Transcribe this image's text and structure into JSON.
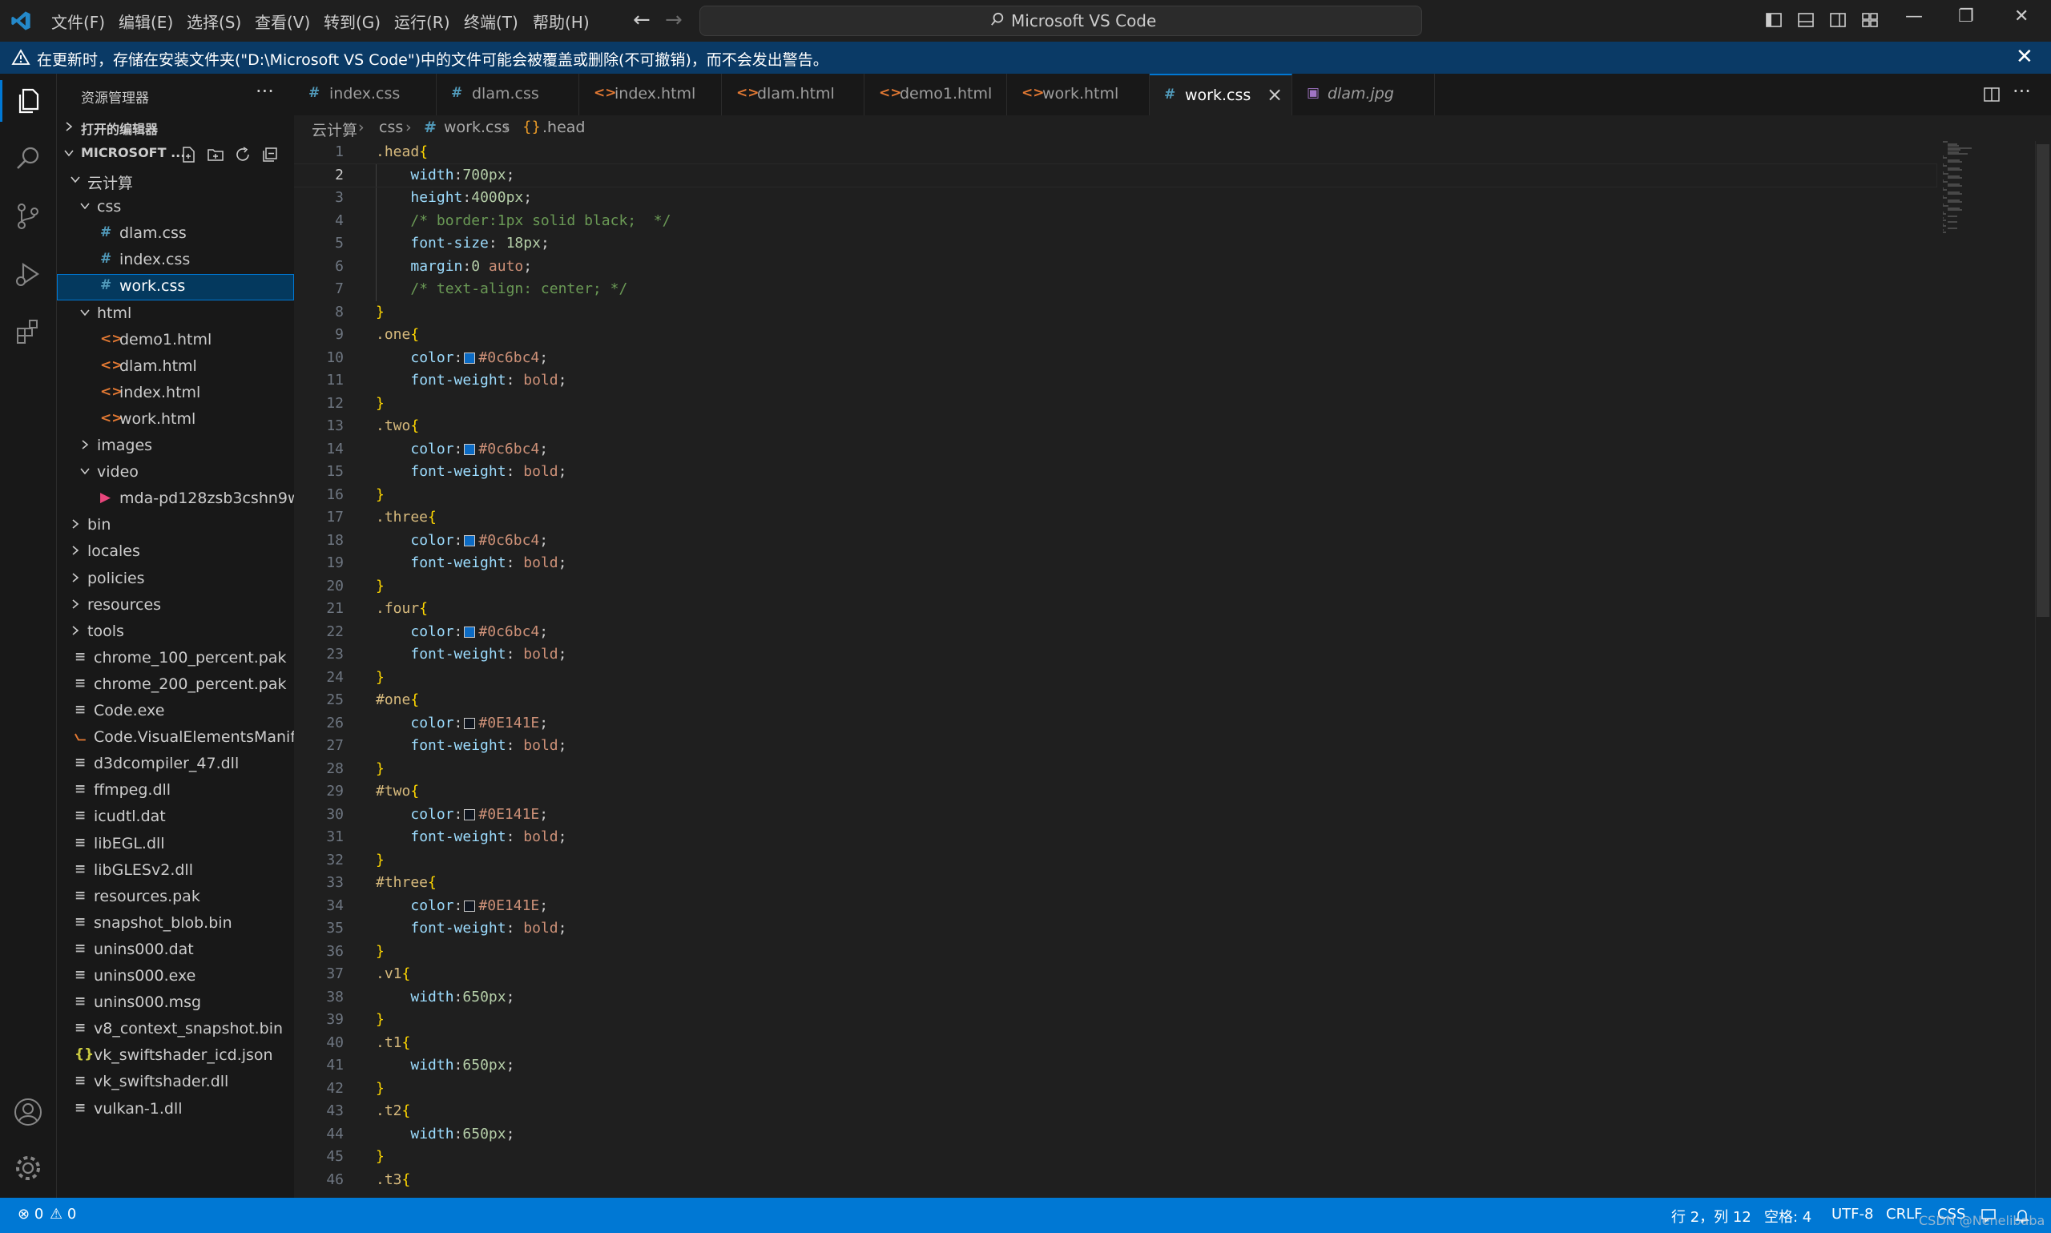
{
  "titlebar": {
    "menus": [
      "文件(F)",
      "编辑(E)",
      "选择(S)",
      "查看(V)",
      "转到(G)",
      "运行(R)",
      "终端(T)",
      "帮助(H)"
    ],
    "command_center": "Microsoft VS Code",
    "window_controls": {
      "minimize": "—",
      "restore": "❐",
      "close": "✕"
    }
  },
  "notification": {
    "message": "在更新时，存储在安装文件夹(\"D:\\Microsoft VS Code\")中的文件可能会被覆盖或删除(不可撤销)，而不会发出警告。",
    "close": "✕"
  },
  "sidebar": {
    "title": "资源管理器",
    "more": "···",
    "open_editors": "打开的编辑器",
    "folder_header": "MICROSOFT ...",
    "tree": [
      {
        "label": "云计算",
        "depth": 1,
        "kind": "folder",
        "open": true
      },
      {
        "label": "css",
        "depth": 2,
        "kind": "folder",
        "open": true
      },
      {
        "label": "dlam.css",
        "depth": 3,
        "kind": "css"
      },
      {
        "label": "index.css",
        "depth": 3,
        "kind": "css"
      },
      {
        "label": "work.css",
        "depth": 3,
        "kind": "css",
        "selected": true
      },
      {
        "label": "html",
        "depth": 2,
        "kind": "folder",
        "open": true
      },
      {
        "label": "demo1.html",
        "depth": 3,
        "kind": "html"
      },
      {
        "label": "dlam.html",
        "depth": 3,
        "kind": "html"
      },
      {
        "label": "index.html",
        "depth": 3,
        "kind": "html"
      },
      {
        "label": "work.html",
        "depth": 3,
        "kind": "html"
      },
      {
        "label": "images",
        "depth": 2,
        "kind": "folder",
        "open": false
      },
      {
        "label": "video",
        "depth": 2,
        "kind": "folder",
        "open": true
      },
      {
        "label": "mda-pd128zsb3cshn9w...",
        "depth": 3,
        "kind": "video"
      },
      {
        "label": "bin",
        "depth": 1,
        "kind": "folder",
        "open": false
      },
      {
        "label": "locales",
        "depth": 1,
        "kind": "folder",
        "open": false
      },
      {
        "label": "policies",
        "depth": 1,
        "kind": "folder",
        "open": false
      },
      {
        "label": "resources",
        "depth": 1,
        "kind": "folder",
        "open": false
      },
      {
        "label": "tools",
        "depth": 1,
        "kind": "folder",
        "open": false
      },
      {
        "label": "chrome_100_percent.pak",
        "depth": 1,
        "kind": "file"
      },
      {
        "label": "chrome_200_percent.pak",
        "depth": 1,
        "kind": "file"
      },
      {
        "label": "Code.exe",
        "depth": 1,
        "kind": "file"
      },
      {
        "label": "Code.VisualElementsManif...",
        "depth": 1,
        "kind": "rss"
      },
      {
        "label": "d3dcompiler_47.dll",
        "depth": 1,
        "kind": "file"
      },
      {
        "label": "ffmpeg.dll",
        "depth": 1,
        "kind": "file"
      },
      {
        "label": "icudtl.dat",
        "depth": 1,
        "kind": "file"
      },
      {
        "label": "libEGL.dll",
        "depth": 1,
        "kind": "file"
      },
      {
        "label": "libGLESv2.dll",
        "depth": 1,
        "kind": "file"
      },
      {
        "label": "resources.pak",
        "depth": 1,
        "kind": "file"
      },
      {
        "label": "snapshot_blob.bin",
        "depth": 1,
        "kind": "file"
      },
      {
        "label": "unins000.dat",
        "depth": 1,
        "kind": "file"
      },
      {
        "label": "unins000.exe",
        "depth": 1,
        "kind": "file"
      },
      {
        "label": "unins000.msg",
        "depth": 1,
        "kind": "file"
      },
      {
        "label": "v8_context_snapshot.bin",
        "depth": 1,
        "kind": "file"
      },
      {
        "label": "vk_swiftshader_icd.json",
        "depth": 1,
        "kind": "json"
      },
      {
        "label": "vk_swiftshader.dll",
        "depth": 1,
        "kind": "file"
      },
      {
        "label": "vulkan-1.dll",
        "depth": 1,
        "kind": "file"
      }
    ]
  },
  "tabs": [
    {
      "label": "index.css",
      "kind": "css"
    },
    {
      "label": "dlam.css",
      "kind": "css"
    },
    {
      "label": "index.html",
      "kind": "html"
    },
    {
      "label": "dlam.html",
      "kind": "html"
    },
    {
      "label": "demo1.html",
      "kind": "html"
    },
    {
      "label": "work.html",
      "kind": "html"
    },
    {
      "label": "work.css",
      "kind": "css",
      "active": true
    },
    {
      "label": "dlam.jpg",
      "kind": "image",
      "preview": true
    }
  ],
  "breadcrumb": [
    "云计算",
    "css",
    "work.css",
    ".head"
  ],
  "editor": {
    "current_line": 2,
    "lines": [
      [
        [
          "sel",
          ".head"
        ],
        [
          "brace",
          "{"
        ]
      ],
      [
        [
          "ind",
          ""
        ],
        [
          "prop",
          "width"
        ],
        [
          "pun",
          ":"
        ],
        [
          "num",
          "700px"
        ],
        [
          "pun",
          ";"
        ]
      ],
      [
        [
          "ind",
          ""
        ],
        [
          "prop",
          "height"
        ],
        [
          "pun",
          ":"
        ],
        [
          "num",
          "4000px"
        ],
        [
          "pun",
          ";"
        ]
      ],
      [
        [
          "ind",
          ""
        ],
        [
          "com",
          "/* border:1px solid black;  */"
        ]
      ],
      [
        [
          "ind",
          ""
        ],
        [
          "prop",
          "font-size"
        ],
        [
          "pun",
          ": "
        ],
        [
          "num",
          "18px"
        ],
        [
          "pun",
          ";"
        ]
      ],
      [
        [
          "ind",
          ""
        ],
        [
          "prop",
          "margin"
        ],
        [
          "pun",
          ":"
        ],
        [
          "num",
          "0"
        ],
        [
          "val",
          " auto"
        ],
        [
          "pun",
          ";"
        ]
      ],
      [
        [
          "ind",
          ""
        ],
        [
          "com",
          "/* text-align: center; */"
        ]
      ],
      [
        [
          "brace",
          "}"
        ]
      ],
      [
        [
          "sel",
          ".one"
        ],
        [
          "brace",
          "{"
        ]
      ],
      [
        [
          "ind",
          ""
        ],
        [
          "prop",
          "color"
        ],
        [
          "pun",
          ":"
        ],
        [
          "sw",
          "#0c6bc4"
        ],
        [
          "val",
          "#0c6bc4"
        ],
        [
          "pun",
          ";"
        ]
      ],
      [
        [
          "ind",
          ""
        ],
        [
          "prop",
          "font-weight"
        ],
        [
          "pun",
          ": "
        ],
        [
          "val",
          "bold"
        ],
        [
          "pun",
          ";"
        ]
      ],
      [
        [
          "brace",
          "}"
        ]
      ],
      [
        [
          "sel",
          ".two"
        ],
        [
          "brace",
          "{"
        ]
      ],
      [
        [
          "ind",
          ""
        ],
        [
          "prop",
          "color"
        ],
        [
          "pun",
          ":"
        ],
        [
          "sw",
          "#0c6bc4"
        ],
        [
          "val",
          "#0c6bc4"
        ],
        [
          "pun",
          ";"
        ]
      ],
      [
        [
          "ind",
          ""
        ],
        [
          "prop",
          "font-weight"
        ],
        [
          "pun",
          ": "
        ],
        [
          "val",
          "bold"
        ],
        [
          "pun",
          ";"
        ]
      ],
      [
        [
          "brace",
          "}"
        ]
      ],
      [
        [
          "sel",
          ".three"
        ],
        [
          "brace",
          "{"
        ]
      ],
      [
        [
          "ind",
          ""
        ],
        [
          "prop",
          "color"
        ],
        [
          "pun",
          ":"
        ],
        [
          "sw",
          "#0c6bc4"
        ],
        [
          "val",
          "#0c6bc4"
        ],
        [
          "pun",
          ";"
        ]
      ],
      [
        [
          "ind",
          ""
        ],
        [
          "prop",
          "font-weight"
        ],
        [
          "pun",
          ": "
        ],
        [
          "val",
          "bold"
        ],
        [
          "pun",
          ";"
        ]
      ],
      [
        [
          "brace",
          "}"
        ]
      ],
      [
        [
          "sel",
          ".four"
        ],
        [
          "brace",
          "{"
        ]
      ],
      [
        [
          "ind",
          ""
        ],
        [
          "prop",
          "color"
        ],
        [
          "pun",
          ":"
        ],
        [
          "sw",
          "#0c6bc4"
        ],
        [
          "val",
          "#0c6bc4"
        ],
        [
          "pun",
          ";"
        ]
      ],
      [
        [
          "ind",
          ""
        ],
        [
          "prop",
          "font-weight"
        ],
        [
          "pun",
          ": "
        ],
        [
          "val",
          "bold"
        ],
        [
          "pun",
          ";"
        ]
      ],
      [
        [
          "brace",
          "}"
        ]
      ],
      [
        [
          "sel",
          "#one"
        ],
        [
          "brace",
          "{"
        ]
      ],
      [
        [
          "ind",
          ""
        ],
        [
          "prop",
          "color"
        ],
        [
          "pun",
          ":"
        ],
        [
          "sw",
          "#0E141E"
        ],
        [
          "val",
          "#0E141E"
        ],
        [
          "pun",
          ";"
        ]
      ],
      [
        [
          "ind",
          ""
        ],
        [
          "prop",
          "font-weight"
        ],
        [
          "pun",
          ": "
        ],
        [
          "val",
          "bold"
        ],
        [
          "pun",
          ";"
        ]
      ],
      [
        [
          "brace",
          "}"
        ]
      ],
      [
        [
          "sel",
          "#two"
        ],
        [
          "brace",
          "{"
        ]
      ],
      [
        [
          "ind",
          ""
        ],
        [
          "prop",
          "color"
        ],
        [
          "pun",
          ":"
        ],
        [
          "sw",
          "#0E141E"
        ],
        [
          "val",
          "#0E141E"
        ],
        [
          "pun",
          ";"
        ]
      ],
      [
        [
          "ind",
          ""
        ],
        [
          "prop",
          "font-weight"
        ],
        [
          "pun",
          ": "
        ],
        [
          "val",
          "bold"
        ],
        [
          "pun",
          ";"
        ]
      ],
      [
        [
          "brace",
          "}"
        ]
      ],
      [
        [
          "sel",
          "#three"
        ],
        [
          "brace",
          "{"
        ]
      ],
      [
        [
          "ind",
          ""
        ],
        [
          "prop",
          "color"
        ],
        [
          "pun",
          ":"
        ],
        [
          "sw",
          "#0E141E"
        ],
        [
          "val",
          "#0E141E"
        ],
        [
          "pun",
          ";"
        ]
      ],
      [
        [
          "ind",
          ""
        ],
        [
          "prop",
          "font-weight"
        ],
        [
          "pun",
          ": "
        ],
        [
          "val",
          "bold"
        ],
        [
          "pun",
          ";"
        ]
      ],
      [
        [
          "brace",
          "}"
        ]
      ],
      [
        [
          "sel",
          ".v1"
        ],
        [
          "brace",
          "{"
        ]
      ],
      [
        [
          "ind",
          ""
        ],
        [
          "prop",
          "width"
        ],
        [
          "pun",
          ":"
        ],
        [
          "num",
          "650px"
        ],
        [
          "pun",
          ";"
        ]
      ],
      [
        [
          "brace",
          "}"
        ]
      ],
      [
        [
          "sel",
          ".t1"
        ],
        [
          "brace",
          "{"
        ]
      ],
      [
        [
          "ind",
          ""
        ],
        [
          "prop",
          "width"
        ],
        [
          "pun",
          ":"
        ],
        [
          "num",
          "650px"
        ],
        [
          "pun",
          ";"
        ]
      ],
      [
        [
          "brace",
          "}"
        ]
      ],
      [
        [
          "sel",
          ".t2"
        ],
        [
          "brace",
          "{"
        ]
      ],
      [
        [
          "ind",
          ""
        ],
        [
          "prop",
          "width"
        ],
        [
          "pun",
          ":"
        ],
        [
          "num",
          "650px"
        ],
        [
          "pun",
          ";"
        ]
      ],
      [
        [
          "brace",
          "}"
        ]
      ],
      [
        [
          "sel",
          ".t3"
        ],
        [
          "brace",
          "{"
        ]
      ]
    ]
  },
  "statusbar": {
    "errors": "0",
    "warnings": "0",
    "cursor": "行 2，列 12",
    "spaces": "空格: 4",
    "encoding": "UTF-8",
    "eol": "CRLF",
    "language": "CSS"
  },
  "watermark": "CSDN @Nenelibaba",
  "colors": {
    "accent": "#0078d4",
    "notification_bg": "#0a3a66",
    "selection_bg": "#04395e",
    "editor_bg": "#1f1f1f",
    "sidebar_bg": "#181818",
    "css_icon": "#519aba",
    "html_icon": "#e37933"
  }
}
